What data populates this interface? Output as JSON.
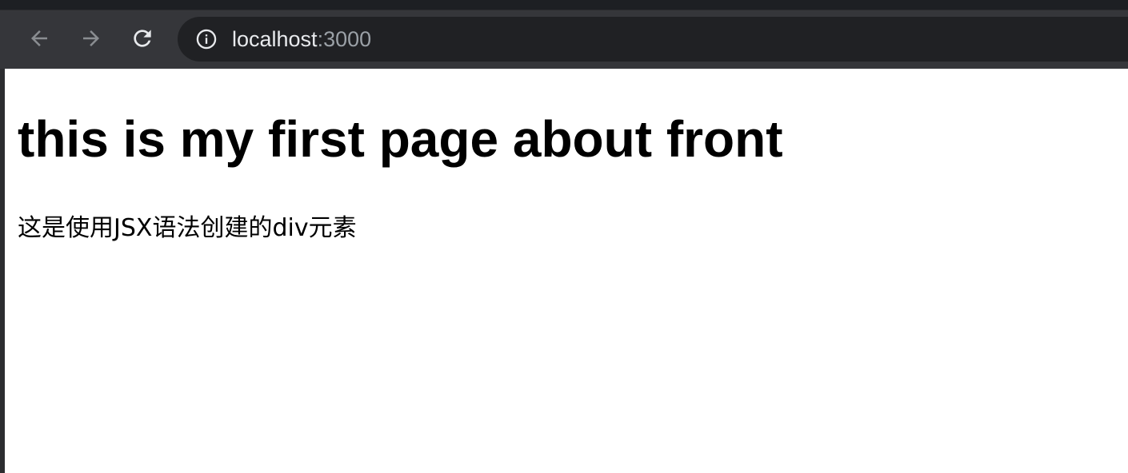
{
  "browser": {
    "toolbar": {
      "back_icon": "arrow-left-icon",
      "forward_icon": "arrow-right-icon",
      "reload_icon": "reload-icon"
    },
    "address_bar": {
      "info_icon": "info-icon",
      "host": "localhost",
      "port": ":3000"
    }
  },
  "page": {
    "heading": "this is my first page about front",
    "paragraph": "这是使用JSX语法创建的div元素"
  },
  "colors": {
    "toolbar_bg": "#35363a",
    "omnibox_bg": "#202124",
    "url_host": "#e8eaed",
    "url_port": "#9aa0a6",
    "icon_disabled": "#8a8d91",
    "icon_active": "#e8eaed"
  }
}
